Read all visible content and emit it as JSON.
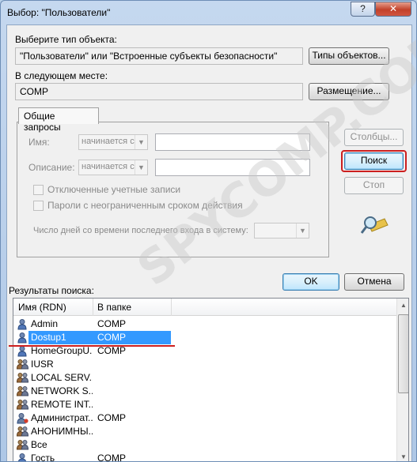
{
  "window": {
    "title": "Выбор: \"Пользователи\"",
    "help": "?",
    "close": "✕"
  },
  "object_type": {
    "label": "Выберите тип объекта:",
    "value": "\"Пользователи\" или \"Встроенные субъекты безопасности\"",
    "button": "Типы объектов..."
  },
  "location": {
    "label": "В следующем месте:",
    "value": "COMP",
    "button": "Размещение..."
  },
  "tab": {
    "label": "Общие запросы"
  },
  "query": {
    "name_label": "Имя:",
    "desc_label": "Описание:",
    "starts_with": "начинается с",
    "disabled_accounts": "Отключенные учетные записи",
    "nonexpiring_pw": "Пароли с неограниченным сроком действия",
    "days_label": "Число дней со времени последнего входа в систему:"
  },
  "buttons": {
    "columns": "Столбцы...",
    "search": "Поиск",
    "stop": "Стоп",
    "ok": "OK",
    "cancel": "Отмена"
  },
  "results": {
    "label": "Результаты поиска:",
    "col_name": "Имя (RDN)",
    "col_folder": "В папке",
    "rows": [
      {
        "name": "Admin",
        "folder": "COMP",
        "icon": "user-icon"
      },
      {
        "name": "Dostup1",
        "folder": "COMP",
        "icon": "user-icon",
        "selected": true
      },
      {
        "name": "HomeGroupU...",
        "folder": "COMP",
        "icon": "user-icon"
      },
      {
        "name": "IUSR",
        "folder": "",
        "icon": "group-icon"
      },
      {
        "name": "LOCAL SERV...",
        "folder": "",
        "icon": "group-icon"
      },
      {
        "name": "NETWORK S...",
        "folder": "",
        "icon": "group-icon"
      },
      {
        "name": "REMOTE INT...",
        "folder": "",
        "icon": "group-icon"
      },
      {
        "name": "Администрат...",
        "folder": "COMP",
        "icon": "admin-user-icon"
      },
      {
        "name": "АНОНИМНЫ...",
        "folder": "",
        "icon": "group-icon"
      },
      {
        "name": "Все",
        "folder": "",
        "icon": "group-icon"
      },
      {
        "name": "Гость",
        "folder": "COMP",
        "icon": "user-icon"
      }
    ]
  },
  "watermark": "SPYCOMP.COM",
  "colors": {
    "selection": "#3399ff",
    "annotation": "#cc1f1f",
    "titlebar": "#b9d1ea"
  }
}
